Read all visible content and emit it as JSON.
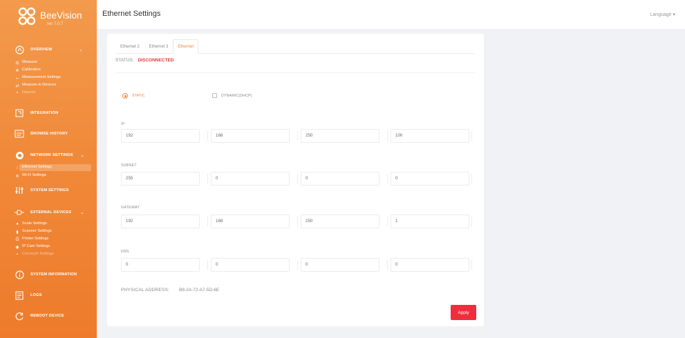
{
  "brand": {
    "name": "BeeVision",
    "version": "ver 7.0.7"
  },
  "sidebar": {
    "sections": [
      {
        "id": "overview",
        "label": "OVERVIEW",
        "icon": "overview-icon",
        "has_chevron": true
      },
      {
        "id": "integration",
        "label": "INTEGRATION",
        "icon": "integration-icon",
        "has_chevron": false
      },
      {
        "id": "browse-history",
        "label": "BROWSE HISTORY",
        "icon": "history-icon",
        "has_chevron": false
      },
      {
        "id": "network-settings",
        "label": "NETWORK SETTINGS",
        "icon": "network-icon",
        "has_chevron": true
      },
      {
        "id": "system-settings",
        "label": "SYSTEM SETTINGS",
        "icon": "sliders-icon",
        "has_chevron": false
      },
      {
        "id": "external-devices",
        "label": "EXTERNAL DEVICES",
        "icon": "plug-icon",
        "has_chevron": true
      },
      {
        "id": "system-information",
        "label": "SYSTEM INFORMATION",
        "icon": "info-icon",
        "has_chevron": false
      },
      {
        "id": "logs",
        "label": "LOGS",
        "icon": "logs-icon",
        "has_chevron": false
      },
      {
        "id": "reboot-device",
        "label": "REBOOT DEVICE",
        "icon": "reboot-icon",
        "has_chevron": false
      }
    ],
    "overview_items": [
      "Measure",
      "Calibration",
      "Measurement Settings",
      "Measure in Devices",
      "Reports"
    ],
    "network_items": [
      "Ethernet Settings",
      "Wi-Fi Settings"
    ],
    "external_items": [
      "Scale Settings",
      "Scanner Settings",
      "Printer Settings",
      "IP Cam Settings",
      "Conveyor Settings"
    ]
  },
  "header": {
    "title": "Ethernet Settings",
    "language": "Language ▾"
  },
  "tabs": [
    "Ethernet 2",
    "Ethernet 3",
    "Ethernet"
  ],
  "active_tab": 2,
  "status": {
    "label": "STATUS:",
    "value": "DISCONNECTED",
    "color": "#e03b3b"
  },
  "mode": {
    "static_label": "STATIC",
    "dynamic_label": "DYNAMIC(DHCP)",
    "selected": "static"
  },
  "fields": [
    {
      "label": "IP",
      "values": [
        "192",
        "168",
        "250",
        "100"
      ]
    },
    {
      "label": "SUBNET",
      "values": [
        "255",
        "0",
        "0",
        "0"
      ]
    },
    {
      "label": "GATEWAY",
      "values": [
        "192",
        "168",
        "250",
        "1"
      ]
    },
    {
      "label": "DNS",
      "values": [
        "0",
        "0",
        "0",
        "0"
      ]
    }
  ],
  "physical_address": {
    "label": "PHYSICAL ADDRESS:",
    "value": "B8-2A-72-A7-5D-6E"
  },
  "apply_label": "Apply",
  "colors": {
    "accent": "#f0873a",
    "apply": "#ee2e3d",
    "sidebar": "#f08a3a"
  }
}
